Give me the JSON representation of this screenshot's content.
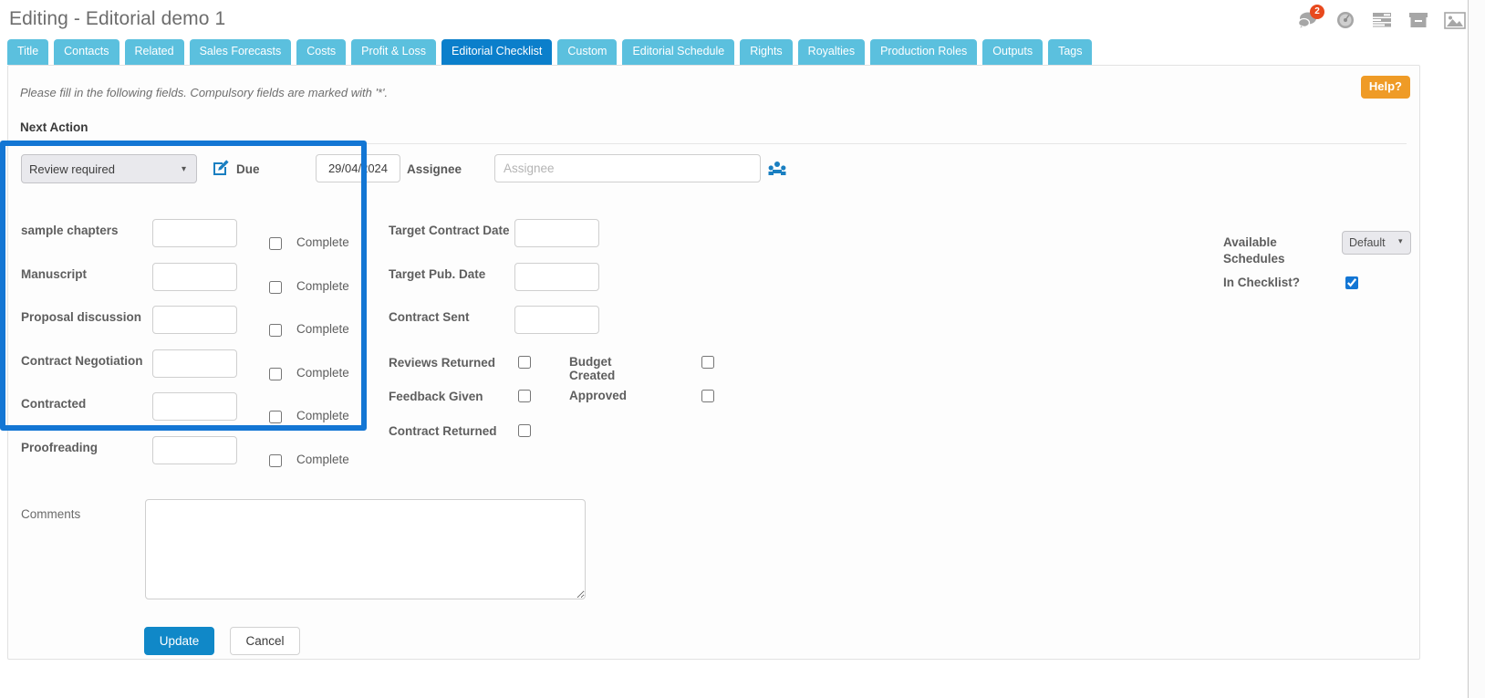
{
  "header": {
    "title": "Editing - Editorial demo 1",
    "icons": [
      {
        "name": "comments-icon",
        "badge": "2"
      },
      {
        "name": "dashboard-icon",
        "badge": ""
      },
      {
        "name": "list-icon",
        "badge": ""
      },
      {
        "name": "archive-icon",
        "badge": ""
      },
      {
        "name": "image-icon",
        "badge": ""
      }
    ]
  },
  "tabs": [
    {
      "label": "Title",
      "active": false
    },
    {
      "label": "Contacts",
      "active": false
    },
    {
      "label": "Related",
      "active": false
    },
    {
      "label": "Sales Forecasts",
      "active": false
    },
    {
      "label": "Costs",
      "active": false
    },
    {
      "label": "Profit & Loss",
      "active": false
    },
    {
      "label": "Editorial Checklist",
      "active": true
    },
    {
      "label": "Custom",
      "active": false
    },
    {
      "label": "Editorial Schedule",
      "active": false
    },
    {
      "label": "Rights",
      "active": false
    },
    {
      "label": "Royalties",
      "active": false
    },
    {
      "label": "Production Roles",
      "active": false
    },
    {
      "label": "Outputs",
      "active": false
    },
    {
      "label": "Tags",
      "active": false
    }
  ],
  "panel": {
    "instructions": "Please fill in the following fields. Compulsory fields are marked with '*'.",
    "help_label": "Help?",
    "section_title": "Next Action"
  },
  "next_action": {
    "status_value": "Review required",
    "status_options": [
      "Review required"
    ],
    "due_label": "Due",
    "due_value": "29/04/2024",
    "assignee_label": "Assignee",
    "assignee_value": "",
    "assignee_placeholder": "Assignee"
  },
  "checklist": {
    "complete_label": "Complete",
    "rows": [
      {
        "label": "sample chapters",
        "value": "",
        "complete": false
      },
      {
        "label": "Manuscript",
        "value": "",
        "complete": false
      },
      {
        "label": "Proposal discussion",
        "value": "",
        "complete": false
      },
      {
        "label": "Contract Negotiation",
        "value": "",
        "complete": false
      },
      {
        "label": "Contracted",
        "value": "",
        "complete": false
      },
      {
        "label": "Proofreading",
        "value": "",
        "complete": false
      }
    ]
  },
  "middle": {
    "date_rows": [
      {
        "label": "Target Contract Date",
        "value": ""
      },
      {
        "label": "Target Pub. Date",
        "value": ""
      },
      {
        "label": "Contract Sent",
        "value": ""
      }
    ],
    "check_rows": [
      {
        "label_a": "Reviews Returned",
        "checked_a": false,
        "label_b": "Budget Created",
        "checked_b": false
      },
      {
        "label_a": "Feedback Given",
        "checked_a": false,
        "label_b": "Approved",
        "checked_b": false
      },
      {
        "label_a": "Contract Returned",
        "checked_a": false,
        "label_b": "",
        "checked_b": null
      }
    ]
  },
  "right": {
    "schedules_label": "Available Schedules",
    "schedules_value": "Default",
    "schedules_options": [
      "Default"
    ],
    "in_checklist_label": "In Checklist?",
    "in_checklist_checked": true
  },
  "comments": {
    "label": "Comments",
    "value": ""
  },
  "actions": {
    "update_label": "Update",
    "cancel_label": "Cancel"
  },
  "colors": {
    "tab": "#5bc0de",
    "tab_active": "#0b7fcb",
    "help": "#ef9b26",
    "primary": "#1088c8",
    "highlight": "#1376d4",
    "badge": "#e8491d"
  }
}
